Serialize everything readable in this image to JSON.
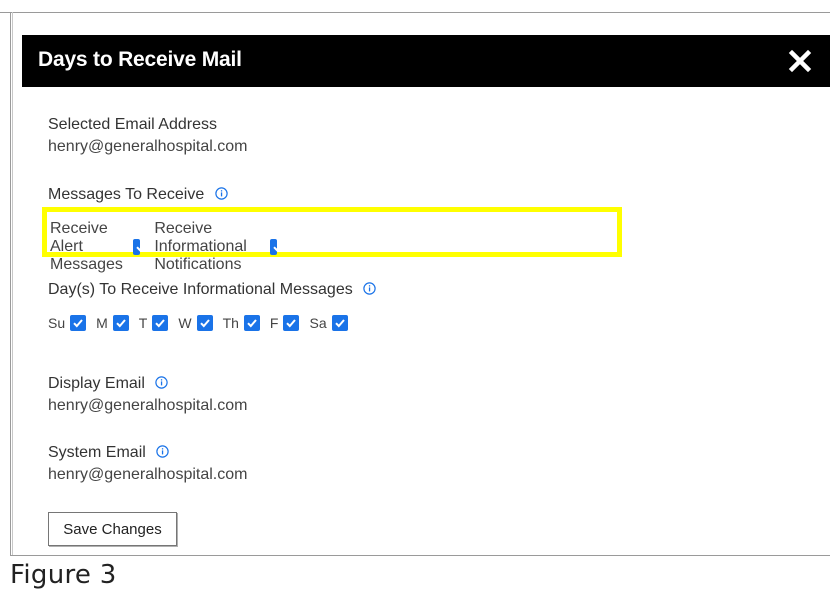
{
  "dialog": {
    "title": "Days to Receive Mail",
    "close_icon": "close-icon"
  },
  "selected_email": {
    "label": "Selected Email Address",
    "value": "henry@generalhospital.com"
  },
  "messages": {
    "label": "Messages To Receive",
    "alert_label": "Receive Alert Messages",
    "alert_checked": true,
    "info_label": "Receive Informational Notifications",
    "info_checked": true,
    "highlight_color": "#ffff00"
  },
  "days": {
    "label": "Day(s) To Receive Informational Messages",
    "items": [
      {
        "label": "Su",
        "checked": true
      },
      {
        "label": "M",
        "checked": true
      },
      {
        "label": "T",
        "checked": true
      },
      {
        "label": "W",
        "checked": true
      },
      {
        "label": "Th",
        "checked": true
      },
      {
        "label": "F",
        "checked": true
      },
      {
        "label": "Sa",
        "checked": true
      }
    ]
  },
  "display_email": {
    "label": "Display Email",
    "value": "henry@generalhospital.com"
  },
  "system_email": {
    "label": "System Email",
    "value": "henry@generalhospital.com"
  },
  "save_button": "Save Changes",
  "caption": "Figure 3",
  "colors": {
    "header_bg": "#000000",
    "checkbox": "#1a73e8",
    "info_icon": "#1a73e8"
  }
}
